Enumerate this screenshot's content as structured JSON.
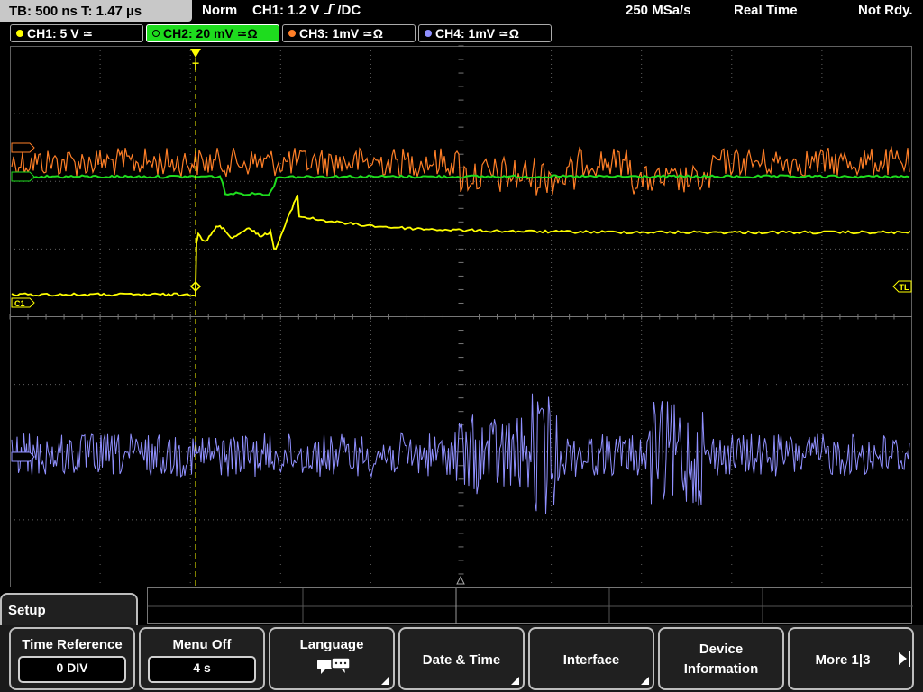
{
  "topbar": {
    "timebase": "TB: 500 ns   T: 1.47 µs",
    "trigger_mode": "Norm",
    "trigger_info": "CH1: 1.2 V",
    "trigger_coupling": "DC",
    "sample_rate": "250 MSa/s",
    "acq_mode": "Real Time",
    "status": "Not Rdy."
  },
  "channels": [
    {
      "label": "CH1: 5 V",
      "coupling_symbol": "≃",
      "color": "#ffff00"
    },
    {
      "label": "CH2: 20 mV",
      "coupling_symbol": "≃Ω",
      "color": "#1edc1e"
    },
    {
      "label": "CH3: 1mV",
      "coupling_symbol": "≃Ω",
      "color": "#ff7f27"
    },
    {
      "label": "CH4: 1mV",
      "coupling_symbol": "≃Ω",
      "color": "#9090ff"
    }
  ],
  "markers": {
    "ch1": "C1",
    "trigger_level": "TL",
    "trigger_pos": "T"
  },
  "menu": {
    "title": "Setup",
    "softkeys": [
      {
        "label": "Time Reference",
        "value": "0 DIV"
      },
      {
        "label": "Menu Off",
        "value": "4 s"
      },
      {
        "label": "Language"
      },
      {
        "label": "Date & Time"
      },
      {
        "label": "Interface"
      },
      {
        "label": "Device",
        "label2": "Information"
      },
      {
        "label": "More 1|3"
      }
    ]
  },
  "colors": {
    "ch1": "#ffff00",
    "ch2": "#1edc1e",
    "ch3": "#ff7f27",
    "ch4": "#9090ff",
    "grid": "#606060"
  }
}
